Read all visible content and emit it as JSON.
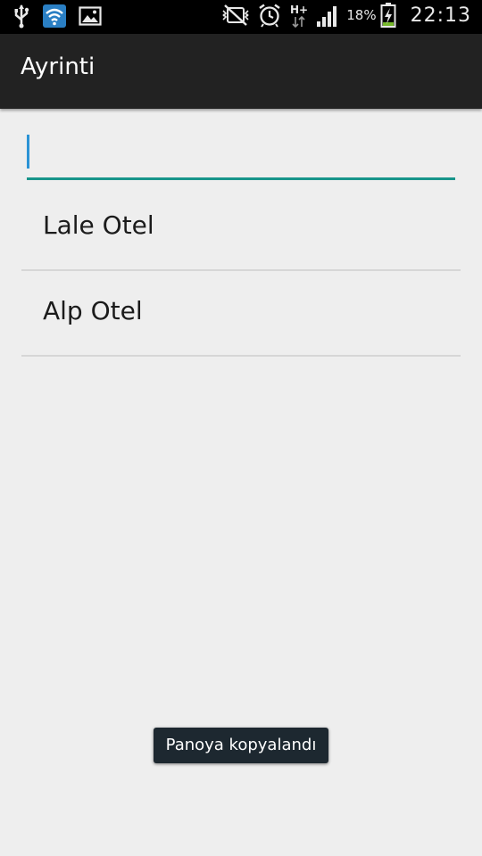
{
  "status_bar": {
    "left_icons": [
      "usb-icon",
      "wifi-icon",
      "image-icon"
    ],
    "right_icons": [
      "mute-icon",
      "alarm-icon",
      "network-hplus-icon",
      "signal-icon"
    ],
    "battery_percent": "18%",
    "time": "22:13"
  },
  "action_bar": {
    "title": "Ayrinti"
  },
  "search": {
    "value": "",
    "placeholder": ""
  },
  "list": {
    "items": [
      {
        "label": "Lale Otel"
      },
      {
        "label": "Alp Otel"
      }
    ]
  },
  "toast": {
    "message": "Panoya kopyalandı"
  },
  "colors": {
    "status_bar_bg": "#000000",
    "action_bar_bg": "#222222",
    "content_bg": "#eeeeee",
    "input_underline": "#17958a",
    "cursor": "#2a93d5",
    "toast_bg": "#1d2830"
  }
}
